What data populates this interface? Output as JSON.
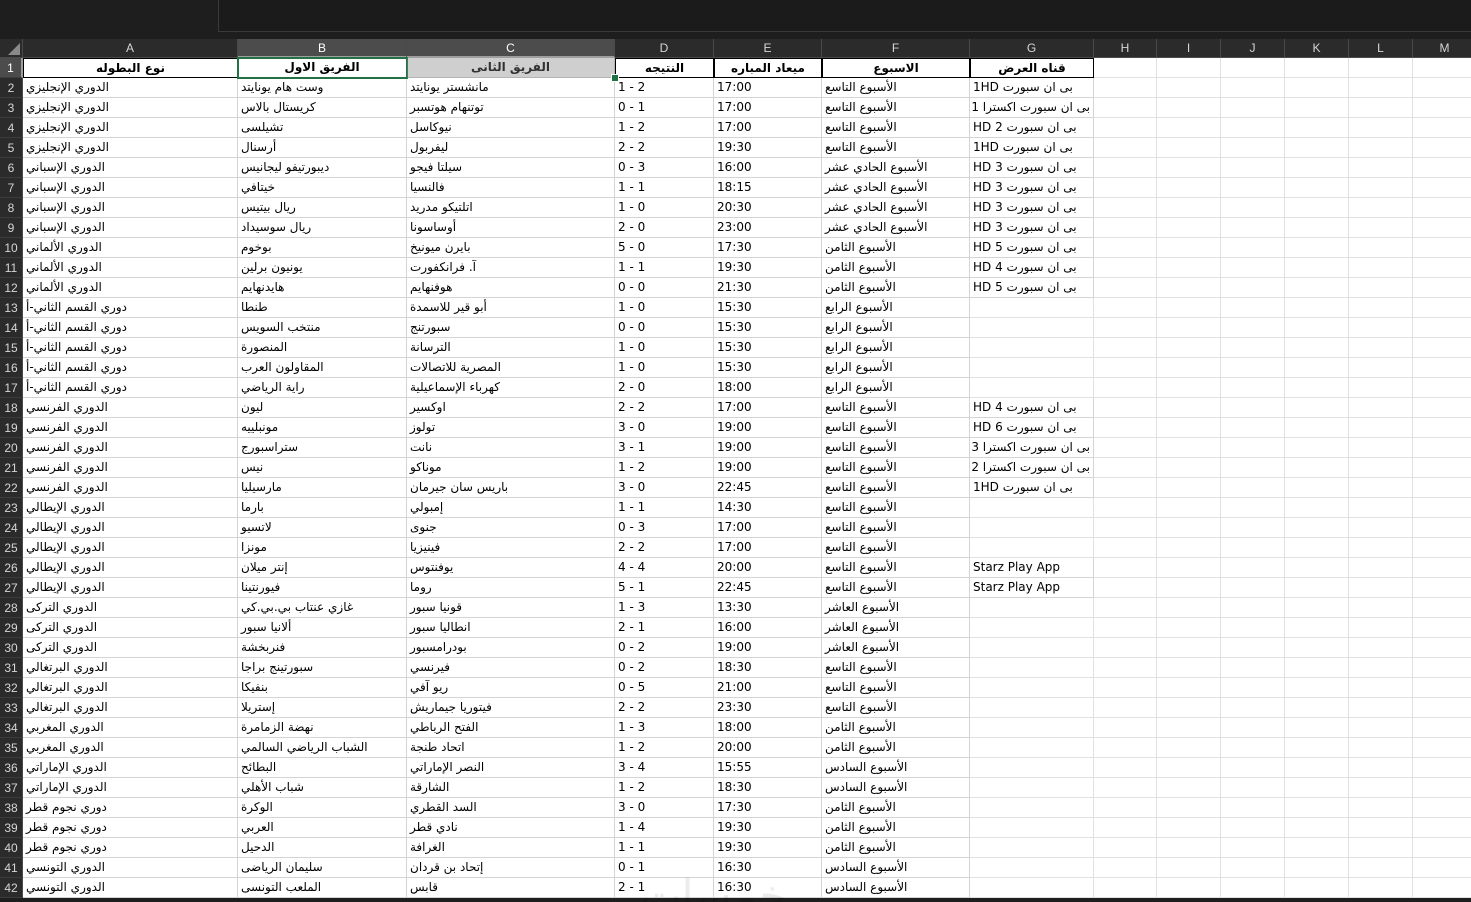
{
  "sheet": {
    "columns": [
      "A",
      "B",
      "C",
      "D",
      "E",
      "F",
      "G",
      "H",
      "I",
      "J",
      "K",
      "L",
      "M"
    ],
    "selected_columns": [
      "B",
      "C"
    ],
    "selected_row": 1,
    "header_row": {
      "A": "نوع البطوله",
      "B": "الفريق الاول",
      "C": "الفريق الثانى",
      "D": "النتيجه",
      "E": "ميعاد المباره",
      "F": "الاسبوع",
      "G": "قناه العرض"
    },
    "rows": [
      {
        "n": 2,
        "A": "الدوري الإنجليزي",
        "B": "وست هام يونايتد",
        "C": "مانشستر يونايتد",
        "D": "1 - 2",
        "E": "17:00",
        "F": "الأسبوع التاسع",
        "G": "بى ان سبورت 1HD"
      },
      {
        "n": 3,
        "A": "الدوري الإنجليزي",
        "B": "كريستال بالاس",
        "C": "توتنهام هوتسبر",
        "D": "0 - 1",
        "E": "17:00",
        "F": "الأسبوع التاسع",
        "G": "بى ان سبورت اكسترا 1"
      },
      {
        "n": 4,
        "A": "الدوري الإنجليزي",
        "B": "تشيلسى",
        "C": "نيوكاسل",
        "D": "1 - 2",
        "E": "17:00",
        "F": "الأسبوع التاسع",
        "G": "بى ان سبورت 2 HD"
      },
      {
        "n": 5,
        "A": "الدوري الإنجليزي",
        "B": "أرسنال",
        "C": "ليفربول",
        "D": "2 - 2",
        "E": "19:30",
        "F": "الأسبوع التاسع",
        "G": "بى ان سبورت 1HD"
      },
      {
        "n": 6,
        "A": "الدوري الإسباني",
        "B": "ديبورتيفو ليجانيس",
        "C": "سيلتا فيجو",
        "D": "0 - 3",
        "E": "16:00",
        "F": "الأسبوع الحادي عشر",
        "G": "بى ان سبورت 3 HD"
      },
      {
        "n": 7,
        "A": "الدوري الإسباني",
        "B": "خيتافي",
        "C": "فالنسيا",
        "D": "1 - 1",
        "E": "18:15",
        "F": "الأسبوع الحادي عشر",
        "G": "بى ان سبورت 3 HD"
      },
      {
        "n": 8,
        "A": "الدوري الإسباني",
        "B": "ريال بيتيس",
        "C": "اتلتيكو مدريد",
        "D": "1 - 0",
        "E": "20:30",
        "F": "الأسبوع الحادي عشر",
        "G": "بى ان سبورت 3 HD"
      },
      {
        "n": 9,
        "A": "الدوري الإسباني",
        "B": "ريال سوسيداد",
        "C": "أوساسونا",
        "D": "2 - 0",
        "E": "23:00",
        "F": "الأسبوع الحادي عشر",
        "G": "بى ان سبورت 3 HD"
      },
      {
        "n": 10,
        "A": "الدوري الألماني",
        "B": "بوخوم",
        "C": "بايرن ميونيخ",
        "D": "5 - 0",
        "E": "17:30",
        "F": "الأسبوع الثامن",
        "G": "بى ان سبورت 5 HD"
      },
      {
        "n": 11,
        "A": "الدوري الألماني",
        "B": "يونيون برلين",
        "C": "آ. فرانكفورت",
        "D": "1 - 1",
        "E": "19:30",
        "F": "الأسبوع الثامن",
        "G": "بى ان سبورت 4 HD"
      },
      {
        "n": 12,
        "A": "الدوري الألماني",
        "B": "هايدنهايم",
        "C": "هوفنهايم",
        "D": "0 - 0",
        "E": "21:30",
        "F": "الأسبوع الثامن",
        "G": "بى ان سبورت 5 HD"
      },
      {
        "n": 13,
        "A": "دوري القسم الثاني-أ",
        "B": "طنطا",
        "C": "أبو قير للاسمدة",
        "D": "1 - 0",
        "E": "15:30",
        "F": "الأسبوع الرابع",
        "G": ""
      },
      {
        "n": 14,
        "A": "دوري القسم الثاني-أ",
        "B": "منتخب السويس",
        "C": "سبورتنج",
        "D": "0 - 0",
        "E": "15:30",
        "F": "الأسبوع الرابع",
        "G": ""
      },
      {
        "n": 15,
        "A": "دوري القسم الثاني-أ",
        "B": "المنصورة",
        "C": "الترسانة",
        "D": "1 - 0",
        "E": "15:30",
        "F": "الأسبوع الرابع",
        "G": ""
      },
      {
        "n": 16,
        "A": "دوري القسم الثاني-أ",
        "B": "المقاولون العرب",
        "C": "المصرية للاتصالات",
        "D": "1 - 0",
        "E": "15:30",
        "F": "الأسبوع الرابع",
        "G": ""
      },
      {
        "n": 17,
        "A": "دوري القسم الثاني-أ",
        "B": "راية الرياضي",
        "C": "كهرباء الإسماعيلية",
        "D": "2 - 0",
        "E": "18:00",
        "F": "الأسبوع الرابع",
        "G": ""
      },
      {
        "n": 18,
        "A": "الدوري الفرنسي",
        "B": "ليون",
        "C": "اوكسير",
        "D": "2 - 2",
        "E": "17:00",
        "F": "الأسبوع التاسع",
        "G": "بى ان سبورت 4 HD"
      },
      {
        "n": 19,
        "A": "الدوري الفرنسي",
        "B": "مونبلييه",
        "C": "تولوز",
        "D": "3 - 0",
        "E": "19:00",
        "F": "الأسبوع التاسع",
        "G": "بى ان سبورت 6 HD"
      },
      {
        "n": 20,
        "A": "الدوري الفرنسي",
        "B": "ستراسبورج",
        "C": "نانت",
        "D": "3 - 1",
        "E": "19:00",
        "F": "الأسبوع التاسع",
        "G": "بى ان سبورت اكسترا 3"
      },
      {
        "n": 21,
        "A": "الدوري الفرنسي",
        "B": "نيس",
        "C": "موناكو",
        "D": "1 - 2",
        "E": "19:00",
        "F": "الأسبوع التاسع",
        "G": "بى ان سبورت اكسترا 2"
      },
      {
        "n": 22,
        "A": "الدوري الفرنسي",
        "B": "مارسيليا",
        "C": "باريس سان جيرمان",
        "D": "3 - 0",
        "E": "22:45",
        "F": "الأسبوع التاسع",
        "G": "بى ان سبورت 1HD"
      },
      {
        "n": 23,
        "A": "الدوري الإيطالي",
        "B": "بارما",
        "C": "إمبولي",
        "D": "1 - 1",
        "E": "14:30",
        "F": "الأسبوع التاسع",
        "G": ""
      },
      {
        "n": 24,
        "A": "الدوري الإيطالي",
        "B": "لاتسيو",
        "C": "جنوى",
        "D": "0 - 3",
        "E": "17:00",
        "F": "الأسبوع التاسع",
        "G": ""
      },
      {
        "n": 25,
        "A": "الدوري الإيطالي",
        "B": "مونزا",
        "C": "فينيزيا",
        "D": "2 - 2",
        "E": "17:00",
        "F": "الأسبوع التاسع",
        "G": ""
      },
      {
        "n": 26,
        "A": "الدوري الإيطالي",
        "B": "إنتر ميلان",
        "C": "يوفنتوس",
        "D": "4 - 4",
        "E": "20:00",
        "F": "الأسبوع التاسع",
        "G": "Starz Play App"
      },
      {
        "n": 27,
        "A": "الدوري الإيطالي",
        "B": "فيورنتينا",
        "C": "روما",
        "D": "5 - 1",
        "E": "22:45",
        "F": "الأسبوع التاسع",
        "G": "Starz Play App"
      },
      {
        "n": 28,
        "A": "الدوري التركى",
        "B": "غازي عنتاب بي.بي.كي",
        "C": "قونيا سبور",
        "D": "1 - 3",
        "E": "13:30",
        "F": "الأسبوع العاشر",
        "G": ""
      },
      {
        "n": 29,
        "A": "الدوري التركى",
        "B": "ألانيا سبور",
        "C": "انطاليا سبور",
        "D": "2 - 1",
        "E": "16:00",
        "F": "الأسبوع العاشر",
        "G": ""
      },
      {
        "n": 30,
        "A": "الدوري التركى",
        "B": "فنربخشة",
        "C": "بودرامسبور",
        "D": "0 - 2",
        "E": "19:00",
        "F": "الأسبوع العاشر",
        "G": ""
      },
      {
        "n": 31,
        "A": "الدوري البرتغالي",
        "B": "سبورتينج براجا",
        "C": "فيرنسي",
        "D": "0 - 2",
        "E": "18:30",
        "F": "الأسبوع التاسع",
        "G": ""
      },
      {
        "n": 32,
        "A": "الدوري البرتغالي",
        "B": "بنفيكا",
        "C": "ريو آفي",
        "D": "0 - 5",
        "E": "21:00",
        "F": "الأسبوع التاسع",
        "G": ""
      },
      {
        "n": 33,
        "A": "الدوري البرتغالي",
        "B": "إستريلا",
        "C": "فيتوريا جيماريش",
        "D": "2 - 2",
        "E": "23:30",
        "F": "الأسبوع التاسع",
        "G": ""
      },
      {
        "n": 34,
        "A": "الدوري المغربي",
        "B": "نهضة الزمامرة",
        "C": "الفتح الرباطي",
        "D": "1 - 3",
        "E": "18:00",
        "F": "الأسبوع الثامن",
        "G": ""
      },
      {
        "n": 35,
        "A": "الدوري المغربي",
        "B": "الشباب الرياضي السالمي",
        "C": "اتحاد طنجة",
        "D": "1 - 2",
        "E": "20:00",
        "F": "الأسبوع الثامن",
        "G": ""
      },
      {
        "n": 36,
        "A": "الدوري الإماراتي",
        "B": "البطائح",
        "C": "النصر الإماراتي",
        "D": "3 - 4",
        "E": "15:55",
        "F": "الأسبوع السادس",
        "G": ""
      },
      {
        "n": 37,
        "A": "الدوري الإماراتي",
        "B": "شباب الأهلي",
        "C": "الشارقة",
        "D": "1 - 2",
        "E": "18:30",
        "F": "الأسبوع السادس",
        "G": ""
      },
      {
        "n": 38,
        "A": "دوري نجوم قطر",
        "B": "الوكرة",
        "C": "السد القطري",
        "D": "3 - 0",
        "E": "17:30",
        "F": "الأسبوع الثامن",
        "G": ""
      },
      {
        "n": 39,
        "A": "دوري نجوم قطر",
        "B": "العربي",
        "C": "نادي قطر",
        "D": "1 - 4",
        "E": "19:30",
        "F": "الأسبوع الثامن",
        "G": ""
      },
      {
        "n": 40,
        "A": "دوري نجوم قطر",
        "B": "الدحيل",
        "C": "الغرافة",
        "D": "1 - 1",
        "E": "19:30",
        "F": "الأسبوع الثامن",
        "G": ""
      },
      {
        "n": 41,
        "A": "الدوري التونسي",
        "B": "سليمان الرياضى",
        "C": "إتحاد بن قردان",
        "D": "0 - 1",
        "E": "16:30",
        "F": "الأسبوع السادس",
        "G": ""
      },
      {
        "n": 42,
        "A": "الدوري التونسي",
        "B": "الملعب التونسى",
        "C": "قابس",
        "D": "2 - 1",
        "E": "16:30",
        "F": "الأسبوع السادس",
        "G": ""
      }
    ]
  },
  "watermark": {
    "text": "خمسات"
  },
  "colors": {
    "chrome_bg": "#1e1e1e",
    "header_bg": "#2b2b2b",
    "header_selected_bg": "#4c4c4c",
    "selection_border": "#217346",
    "grid_line": "#d4d4d4"
  }
}
